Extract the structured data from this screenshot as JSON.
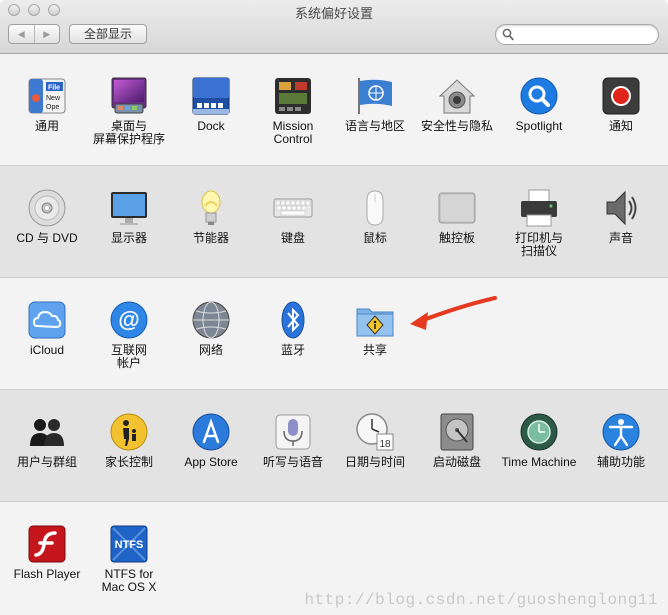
{
  "window": {
    "title": "系统偏好设置"
  },
  "toolbar": {
    "back": "◀",
    "forward": "▶",
    "show_all": "全部显示",
    "search_placeholder": ""
  },
  "rows": [
    [
      {
        "key": "general",
        "label": "通用",
        "icon": "general-icon"
      },
      {
        "key": "desktop",
        "label": "桌面与\n屏幕保护程序",
        "icon": "desktop-icon"
      },
      {
        "key": "dock",
        "label": "Dock",
        "icon": "dock-icon"
      },
      {
        "key": "mission",
        "label": "Mission\nControl",
        "icon": "mission-control-icon"
      },
      {
        "key": "language",
        "label": "语言与地区",
        "icon": "un-flag-icon"
      },
      {
        "key": "security",
        "label": "安全性与隐私",
        "icon": "house-lock-icon"
      },
      {
        "key": "spotlight",
        "label": "Spotlight",
        "icon": "magnifier-icon"
      },
      {
        "key": "notifications",
        "label": "通知",
        "icon": "notifications-icon"
      }
    ],
    [
      {
        "key": "cd",
        "label": "CD 与 DVD",
        "icon": "cd-icon"
      },
      {
        "key": "displays",
        "label": "显示器",
        "icon": "monitor-icon"
      },
      {
        "key": "energy",
        "label": "节能器",
        "icon": "lightbulb-icon"
      },
      {
        "key": "keyboard",
        "label": "键盘",
        "icon": "keyboard-icon"
      },
      {
        "key": "mouse",
        "label": "鼠标",
        "icon": "mouse-icon"
      },
      {
        "key": "trackpad",
        "label": "触控板",
        "icon": "trackpad-icon"
      },
      {
        "key": "printers",
        "label": "打印机与\n扫描仪",
        "icon": "printer-icon"
      },
      {
        "key": "sound",
        "label": "声音",
        "icon": "speaker-icon"
      }
    ],
    [
      {
        "key": "icloud",
        "label": "iCloud",
        "icon": "cloud-icon"
      },
      {
        "key": "accounts",
        "label": "互联网\n帐户",
        "icon": "at-sign-icon"
      },
      {
        "key": "network",
        "label": "网络",
        "icon": "globe-icon"
      },
      {
        "key": "bluetooth",
        "label": "蓝牙",
        "icon": "bluetooth-icon"
      },
      {
        "key": "sharing",
        "label": "共享",
        "icon": "sharing-folder-icon"
      }
    ],
    [
      {
        "key": "users",
        "label": "用户与群组",
        "icon": "users-icon"
      },
      {
        "key": "parental",
        "label": "家长控制",
        "icon": "parental-icon"
      },
      {
        "key": "appstore",
        "label": "App Store",
        "icon": "app-store-icon"
      },
      {
        "key": "dictation",
        "label": "听写与语音",
        "icon": "microphone-icon"
      },
      {
        "key": "datetime",
        "label": "日期与时间",
        "icon": "clock-calendar-icon"
      },
      {
        "key": "startup",
        "label": "启动磁盘",
        "icon": "hard-disk-icon"
      },
      {
        "key": "timemachine",
        "label": "Time Machine",
        "icon": "time-machine-icon"
      },
      {
        "key": "accessibility",
        "label": "辅助功能",
        "icon": "accessibility-icon"
      }
    ],
    [
      {
        "key": "flash",
        "label": "Flash Player",
        "icon": "flash-icon"
      },
      {
        "key": "ntfs",
        "label": "NTFS for\nMac OS X",
        "icon": "ntfs-icon"
      }
    ]
  ],
  "misc": {
    "general_icon_text_1": "File",
    "general_icon_text_2": "New",
    "general_icon_text_3": "Ope",
    "ntfs_icon_text": "NTFS",
    "calendar_day": "18"
  },
  "watermark": "http://blog.csdn.net/guoshenglong11"
}
